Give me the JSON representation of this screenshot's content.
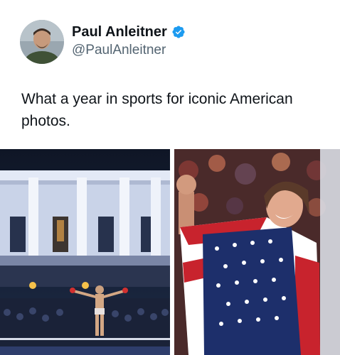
{
  "tweet": {
    "author": {
      "display_name": "Paul Anleitner",
      "handle": "@PaulAnleitner",
      "verified": true,
      "verified_icon": "verified-badge-icon",
      "verified_color": "#1d9bf0"
    },
    "text": "What a year in sports for iconic American photos.",
    "media": [
      {
        "icon": "white-house-wrestler-photo"
      },
      {
        "icon": "hockey-player-flag-photo"
      }
    ]
  }
}
